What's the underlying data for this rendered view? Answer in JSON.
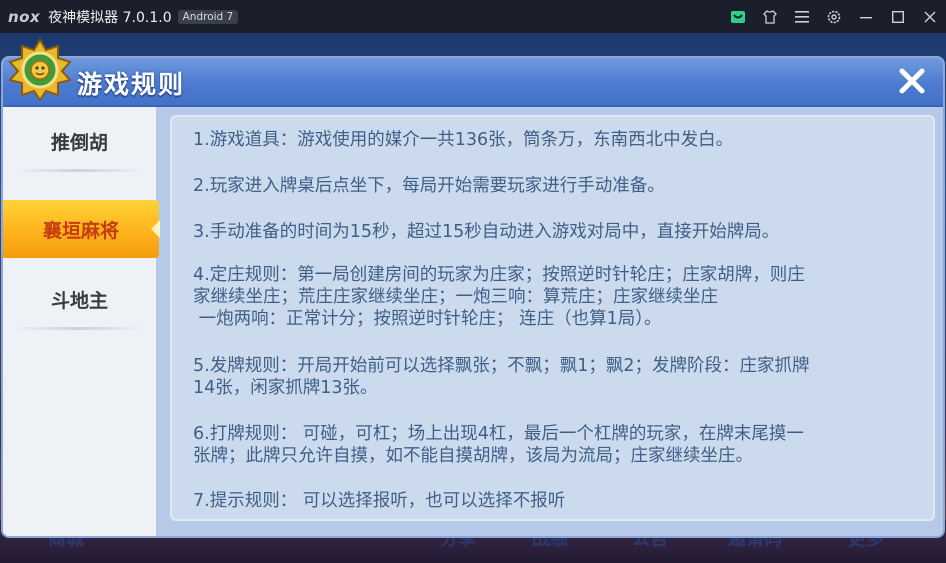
{
  "titlebar": {
    "logo": "nox",
    "title": "夜神模拟器 7.0.1.0",
    "android_badge": "Android 7",
    "icons": [
      "store-icon",
      "shirt-icon",
      "menu-icon",
      "settings-icon",
      "minimize-icon",
      "maximize-icon",
      "close-icon"
    ]
  },
  "dialog": {
    "title": "游戏规则",
    "close_icon": "close-icon"
  },
  "side_menu": {
    "items": [
      {
        "label": "推倒胡",
        "active": false
      },
      {
        "label": "襄垣麻将",
        "active": true
      },
      {
        "label": "斗地主",
        "active": false
      }
    ]
  },
  "rules": [
    "1.游戏道具：游戏使用的媒介一共136张，筒条万，东南西北中发白。",
    "2.玩家进入牌桌后点坐下，每局开始需要玩家进行手动准备。",
    "3.手动准备的时间为15秒，超过15秒自动进入游戏对局中，直接开始牌局。",
    "4.定庄规则：第一局创建房间的玩家为庄家；按照逆时针轮庄；庄家胡牌，则庄",
    "家继续坐庄；荒庄庄家继续坐庄；一炮三响：算荒庄；庄家继续坐庄",
    " 一炮两响：正常计分；按照逆时针轮庄； 连庄（也算1局）。",
    "5.发牌规则：开局开始前可以选择飘张；不飘；飘1；飘2；发牌阶段：庄家抓牌",
    "14张，闲家抓牌13张。",
    "6.打牌规则： 可碰，可杠；场上出现4杠，最后一个杠牌的玩家，在牌末尾摸一",
    "张牌；此牌只允许自摸，如不能自摸胡牌，该局为流局；庄家继续坐庄。",
    "7.提示规则： 可以选择报听，也可以选择不报听"
  ],
  "bottom_bar": {
    "items": [
      "商城",
      "分享",
      "战绩",
      "公告",
      "邀请码",
      "更多"
    ]
  },
  "colors": {
    "header_blue": "#4e7bd0",
    "active_tab": "#ffb31a",
    "active_text": "#c63c10",
    "rule_text": "#3f5f86"
  }
}
